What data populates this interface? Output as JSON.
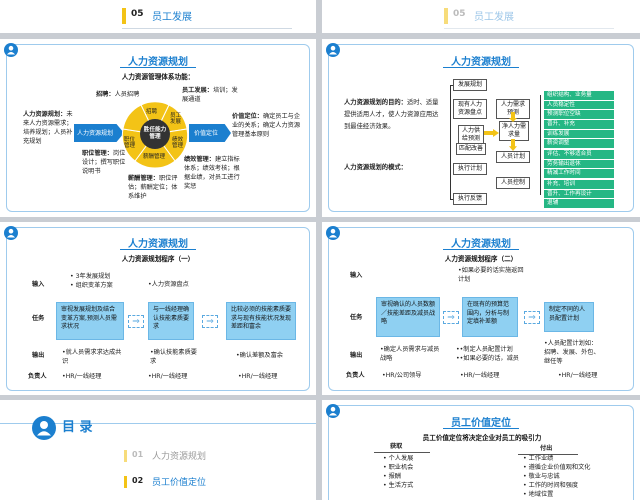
{
  "top_strip": {
    "left_num": "05",
    "left_title": "员工发展",
    "right_num": "05",
    "right_title": "员工发展"
  },
  "slide1": {
    "title": "人力资源规划",
    "subtitle": "人力资源管理体系功能：",
    "left_box": "人力资源规划",
    "right_box": "价值定位",
    "center": "胜任能力管理",
    "petals": [
      "招聘",
      "员工发展",
      "绩效管理",
      "薪酬管理",
      "职位管理"
    ],
    "txt_recruit_head": "招聘：",
    "txt_recruit": "人员招聘",
    "txt_devel_head": "员工发展：",
    "txt_devel": "培训；发展通道",
    "txt_hr_head": "人力资源规划：",
    "txt_hr": "未来人力资源需求；培养规划；人员补充规划",
    "txt_value_head": "价值定位：",
    "txt_value": "确定员工与企业的关系；确定人力资源管理基本原则",
    "txt_pos_head": "职位管理：",
    "txt_pos": "岗位设计；撰写职位说明书",
    "txt_perf_head": "绩效管理：",
    "txt_perf": "建立指标体系；绩效考核；根据业绩，对员工进行奖惩",
    "txt_pay_head": "薪酬管理：",
    "txt_pay": "职位评估；薪酬定位；体系维护"
  },
  "slide2": {
    "title": "人力资源规划",
    "purpose_head": "人力资源规划的目的：",
    "purpose": "适时、适量提供适用人才，使人力资源应用达到最佳经济效果。",
    "mode_head": "人力资源规划的模式：",
    "nodes": {
      "develop_plan": "发展规划",
      "existing": "现有人力资源盘点",
      "demand_forecast": "人力需求预测",
      "supply_forecast": "人力供给预测",
      "net_demand": "净人力需求量",
      "match": "匹配改善",
      "plan": "人员计划",
      "execute": "执行计划",
      "feedback": "执行反馈",
      "check": "人员控制"
    },
    "green1": [
      "组织结构、业务量",
      "人员稳定性",
      "预测职位空缺"
    ],
    "green2": [
      "晋升、补充",
      "训练发展",
      "薪资调整"
    ],
    "green3": [
      "评估、不够适合员",
      "劳务输出退休",
      "精减工作时间"
    ],
    "green4": [
      "补充、培训",
      "晋升、工作再设计",
      "退辅"
    ]
  },
  "slide3": {
    "title": "人力资源规划",
    "subtitle": "人力资源规划程序（一）",
    "row_input": "输入",
    "row_task": "任务",
    "row_output": "输出",
    "row_owner": "负责人",
    "input1": [
      "3年发展规划",
      "组织变革方案"
    ],
    "input2": "人力资源盘点",
    "task1": "审视发展规划及结合变革方案,预测人员需求状况",
    "task2": "与一线经理确认技能素质要求",
    "task3": "比较必须的技能素质要求与现有技能状况发现差距和富余",
    "output1": [
      "就人员需求求达成共识"
    ],
    "output2": [
      "确认技能素质要求"
    ],
    "output3": [
      "确认差额及富余"
    ],
    "owner1": "HR/一线经理",
    "owner2": "HR/一线经理",
    "owner3": "HR/一线经理"
  },
  "slide4": {
    "title": "人力资源规划",
    "subtitle": "人力资源规划程序（二）",
    "row_input": "输入",
    "row_task": "任务",
    "row_output": "输出",
    "row_owner": "负责人",
    "input2": [
      "如果必要的话实施返回计划"
    ],
    "task1": "审视确认的人员数额／技能差距及减员战略",
    "task2": "在既有的预算范围内，分析与制定填补差额",
    "task3": "制定不同的人员配置计划",
    "output1": [
      "确定人员需求与减员战略"
    ],
    "output2": [
      "制定人员配置计划",
      "如果必要的话，减员"
    ],
    "output3": [
      "人员配置计划如：招聘、发展、外包、继任等"
    ],
    "owner1": "HR/公司领导",
    "owner2": "HR/一线经理",
    "owner3": "HR/一线经理"
  },
  "slide5": {
    "heading": "目 录",
    "items": [
      {
        "num": "01",
        "label": "人力资源规划"
      },
      {
        "num": "02",
        "label": "员工价值定位"
      }
    ]
  },
  "slide6": {
    "title": "员工价值定位",
    "subtitle": "员工价值定位将决定企业对员工的吸引力",
    "col_left": "获取",
    "col_right": "付出",
    "left_items": [
      "个人发展",
      "职业机会",
      "报酬",
      "生活方式"
    ],
    "right_items": [
      "工作业绩",
      "遵循企业价值观和文化",
      "敬业与忠诚",
      "工作的时间和强度",
      "地域位置"
    ]
  },
  "colors": {
    "brand": "#1b7fcf",
    "light": "#8fd0f2",
    "green": "#25b784",
    "yellow": "#f3c316"
  }
}
